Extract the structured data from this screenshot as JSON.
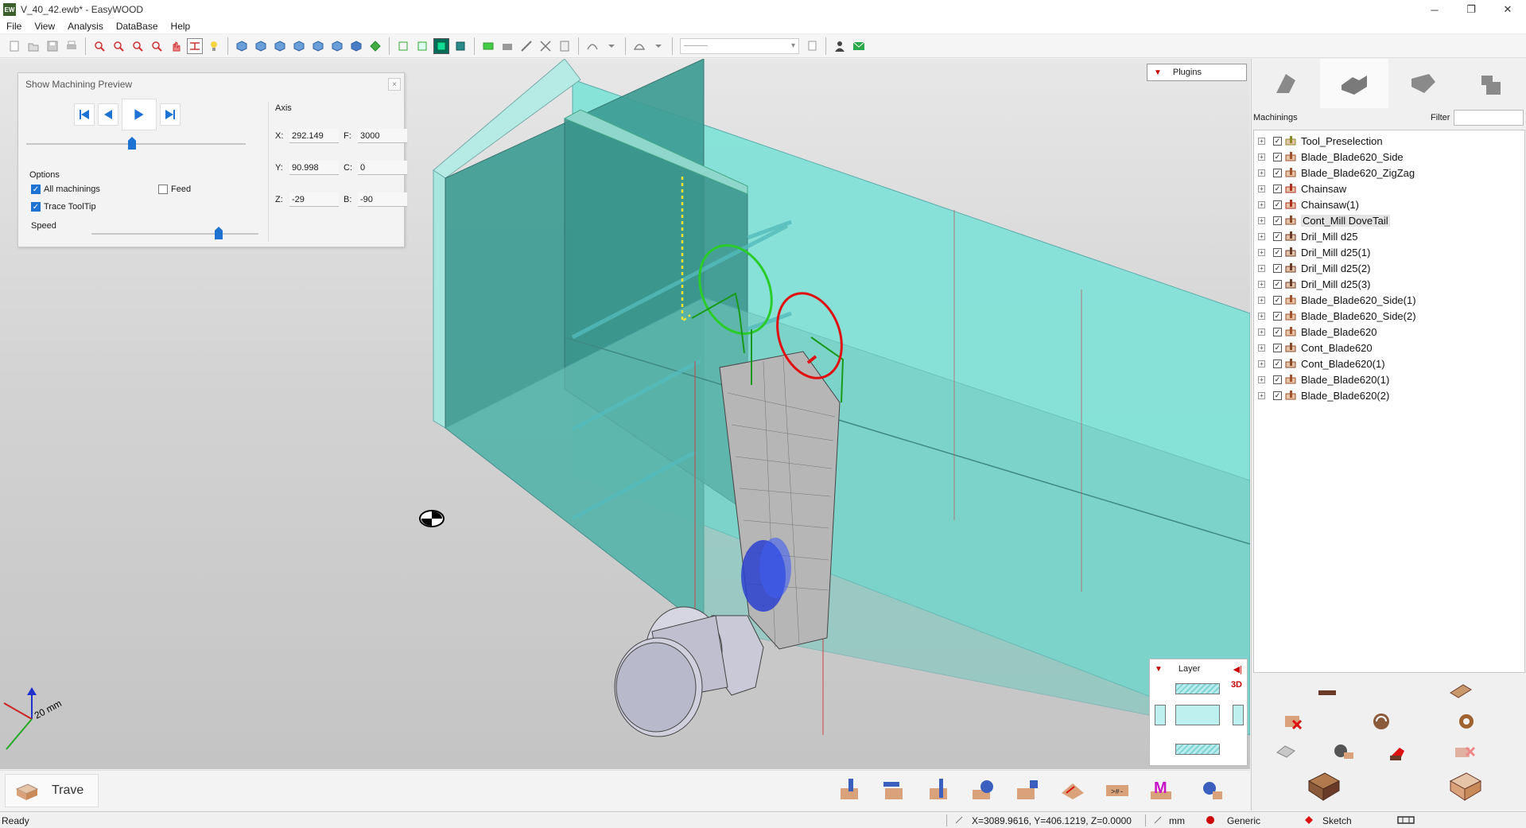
{
  "window": {
    "title": "V_40_42.ewb* - EasyWOOD",
    "app_icon": "EW",
    "controls": [
      "─",
      "❐",
      "✕"
    ]
  },
  "menu": [
    "File",
    "View",
    "Analysis",
    "DataBase",
    "Help"
  ],
  "toolbar": {
    "combo_value": "———"
  },
  "preview": {
    "title": "Show Machining Preview",
    "close": "×",
    "options_label": "Options",
    "all_machinings": "All machinings",
    "all_machinings_checked": true,
    "feed": "Feed",
    "feed_checked": false,
    "trace_tooltip": "Trace ToolTip",
    "trace_tooltip_checked": true,
    "speed": "Speed",
    "position": 0.42,
    "speed_level": 0.78,
    "axis_label": "Axis",
    "axis": {
      "x_key": "X:",
      "x": "292.149",
      "f_key": "F:",
      "f": "3000",
      "y_key": "Y:",
      "y": "90.998",
      "c_key": "C:",
      "c": "0",
      "z_key": "Z:",
      "z": "-29",
      "b_key": "B:",
      "b": "-90"
    }
  },
  "plugins": {
    "label": "Plugins"
  },
  "layer": {
    "label": "Layer",
    "mode": "3D"
  },
  "view_axis": {
    "label": "20 mm"
  },
  "right_panel": {
    "machinings_label": "Machinings",
    "filter_label": "Filter",
    "filter_value": "",
    "items": [
      {
        "label": "Tool_Preselection",
        "icon": "preselection-icon",
        "selected": false
      },
      {
        "label": "Blade_Blade620_Side",
        "icon": "blade-icon",
        "selected": false
      },
      {
        "label": "Blade_Blade620_ZigZag",
        "icon": "blade-icon",
        "selected": false
      },
      {
        "label": "Chainsaw",
        "icon": "chainsaw-icon",
        "selected": false
      },
      {
        "label": "Chainsaw(1)",
        "icon": "chainsaw-icon",
        "selected": false
      },
      {
        "label": "Cont_Mill DoveTail",
        "icon": "contour-icon",
        "selected": true
      },
      {
        "label": "Dril_Mill d25",
        "icon": "drill-mill-icon",
        "selected": false
      },
      {
        "label": "Dril_Mill d25(1)",
        "icon": "drill-mill-icon",
        "selected": false
      },
      {
        "label": "Dril_Mill d25(2)",
        "icon": "drill-mill-icon",
        "selected": false
      },
      {
        "label": "Dril_Mill d25(3)",
        "icon": "drill-mill-icon",
        "selected": false
      },
      {
        "label": "Blade_Blade620_Side(1)",
        "icon": "blade-icon",
        "selected": false
      },
      {
        "label": "Blade_Blade620_Side(2)",
        "icon": "blade-icon",
        "selected": false
      },
      {
        "label": "Blade_Blade620",
        "icon": "blade-icon",
        "selected": false
      },
      {
        "label": "Cont_Blade620",
        "icon": "contour-icon",
        "selected": false
      },
      {
        "label": "Cont_Blade620(1)",
        "icon": "contour-icon",
        "selected": false
      },
      {
        "label": "Blade_Blade620(1)",
        "icon": "blade-icon",
        "selected": false
      },
      {
        "label": "Blade_Blade620(2)",
        "icon": "blade-icon",
        "selected": false
      }
    ]
  },
  "bottom": {
    "part_name": "Trave"
  },
  "status": {
    "ready": "Ready",
    "coords": "X=3089.9616, Y=406.1219, Z=0.0000",
    "unit": "mm",
    "machine": "Generic",
    "mode": "Sketch"
  },
  "colors": {
    "wood_cyan": "#7fdcd2",
    "accent_blue": "#1e73d2",
    "brand_red": "#c00000"
  }
}
